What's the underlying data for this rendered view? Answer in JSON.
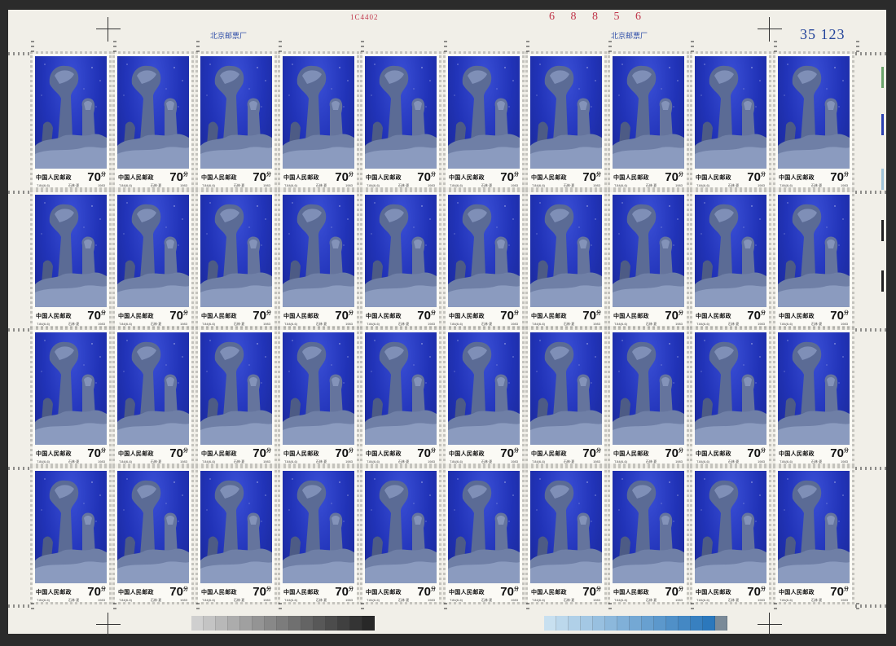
{
  "sheet": {
    "plate_number": "1C4402",
    "serial_number": "6 8 8 5 6",
    "printer_inscription_left": "北京邮票厂",
    "printer_inscription_right": "北京邮票厂",
    "sheet_counter": "35 123"
  },
  "stamp": {
    "country": "中国人民邮政",
    "value": "70",
    "unit": "分",
    "code": "T.84(6-6)",
    "subject": "石林·夏",
    "year": "1983"
  },
  "layout_info": {
    "rows": 4,
    "columns": 10
  },
  "colors": {
    "sky": "#2133b8",
    "rock": "#4a5a86",
    "margin": "#f1efe8",
    "inscription_blue": "#2f4ea8",
    "serial_red": "#c0364a"
  },
  "color_bar_left": [
    "#cfcfcf",
    "#c4c4c4",
    "#b8b8b8",
    "#acacac",
    "#a0a0a0",
    "#949494",
    "#888888",
    "#7c7c7c",
    "#707070",
    "#646464",
    "#585858",
    "#4c4c4c",
    "#404040",
    "#343434",
    "#282828"
  ],
  "color_bar_right": [
    "#c8e0f0",
    "#bcd8ec",
    "#b0d0e8",
    "#a4c8e4",
    "#98c0e0",
    "#8cb8dc",
    "#80b0d8",
    "#74a8d4",
    "#68a0d0",
    "#5c98cc",
    "#5090c8",
    "#4488c4",
    "#3880c0",
    "#2c78bc",
    "#7a8a98"
  ],
  "side_marks": [
    "#6aa36a",
    "#2a3fb0",
    "#9fc3d8",
    "#222222",
    "#222222"
  ]
}
